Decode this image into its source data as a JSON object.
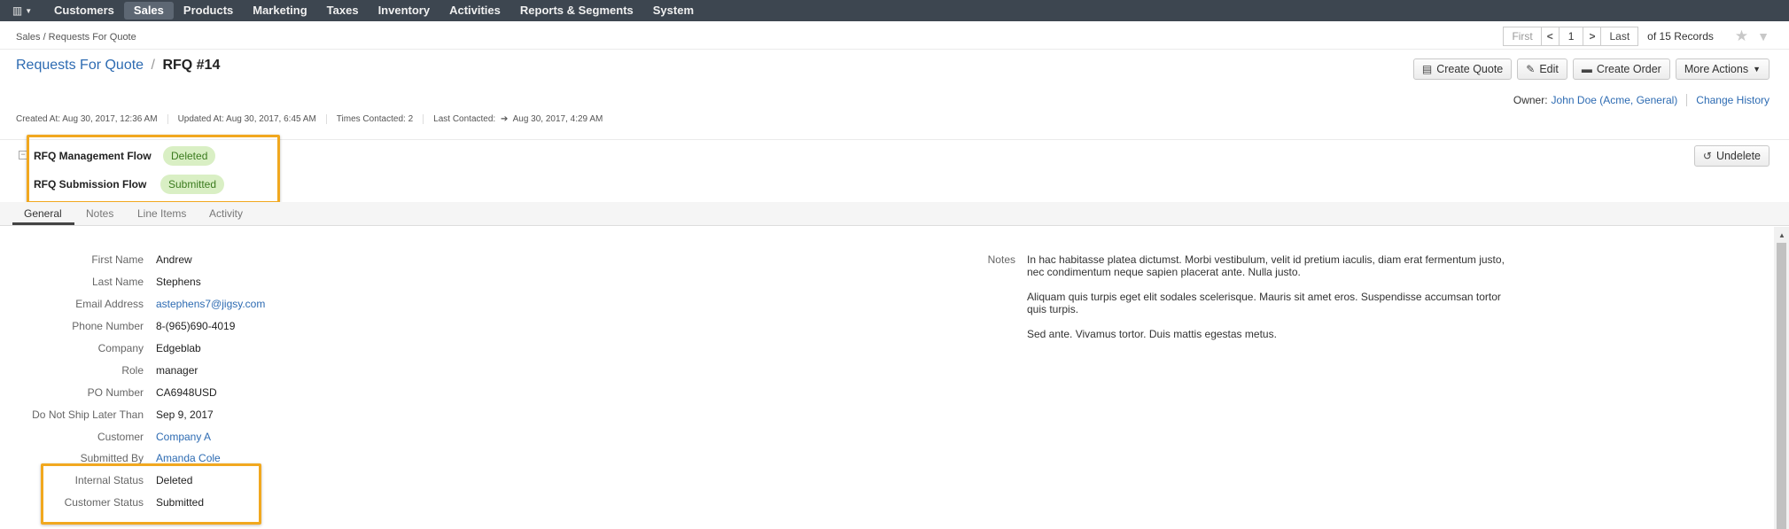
{
  "nav": {
    "items": [
      "Customers",
      "Sales",
      "Products",
      "Marketing",
      "Taxes",
      "Inventory",
      "Activities",
      "Reports & Segments",
      "System"
    ],
    "active": "Sales"
  },
  "breadcrumb": "Sales / Requests For Quote",
  "pager": {
    "first": "First",
    "page": "1",
    "last": "Last",
    "count": "of 15 Records"
  },
  "title": {
    "parent": "Requests For Quote",
    "separator": "/",
    "current": "RFQ #14"
  },
  "actions": {
    "create_quote": "Create Quote",
    "edit": "Edit",
    "create_order": "Create Order",
    "more_actions": "More Actions"
  },
  "owner": {
    "label": "Owner:",
    "value": "John Doe (Acme, General)",
    "change_history": "Change History"
  },
  "meta": {
    "created": "Created At: Aug 30, 2017, 12:36 AM",
    "updated": "Updated At: Aug 30, 2017, 6:45 AM",
    "times_contacted": "Times Contacted: 2",
    "last_contacted_label": "Last Contacted:",
    "last_contacted_value": "Aug 30, 2017, 4:29 AM"
  },
  "workflow": {
    "toggle": "−",
    "rows": [
      {
        "label": "RFQ Management Flow",
        "status": "Deleted"
      },
      {
        "label": "RFQ Submission Flow",
        "status": "Submitted"
      }
    ],
    "undelete": "Undelete"
  },
  "tabs": [
    "General",
    "Notes",
    "Line Items",
    "Activity"
  ],
  "fields": [
    {
      "label": "First Name",
      "value": "Andrew"
    },
    {
      "label": "Last Name",
      "value": "Stephens"
    },
    {
      "label": "Email Address",
      "value": "astephens7@jigsy.com"
    },
    {
      "label": "Phone Number",
      "value": "8-(965)690-4019"
    },
    {
      "label": "Company",
      "value": "Edgeblab"
    },
    {
      "label": "Role",
      "value": "manager"
    },
    {
      "label": "PO Number",
      "value": "CA6948USD"
    },
    {
      "label": "Do Not Ship Later Than",
      "value": "Sep 9, 2017"
    },
    {
      "label": "Customer",
      "value": "Company A"
    },
    {
      "label": "Submitted By",
      "value": "Amanda Cole"
    },
    {
      "label": "Internal Status",
      "value": "Deleted"
    },
    {
      "label": "Customer Status",
      "value": "Submitted"
    }
  ],
  "notes": {
    "label": "Notes",
    "paragraphs": [
      "In hac habitasse platea dictumst. Morbi vestibulum, velit id pretium iaculis, diam erat fermentum justo, nec condimentum neque sapien placerat ante. Nulla justo.",
      "Aliquam quis turpis eget elit sodales scelerisque. Mauris sit amet eros. Suspendisse accumsan tortor quis turpis.",
      "Sed ante. Vivamus tortor. Duis mattis egestas metus."
    ]
  },
  "colors": {
    "topnav_bg": "#3d4650",
    "link": "#2d6bb2",
    "badge_bg": "#d9efc4",
    "highlight": "#f1a81f"
  }
}
